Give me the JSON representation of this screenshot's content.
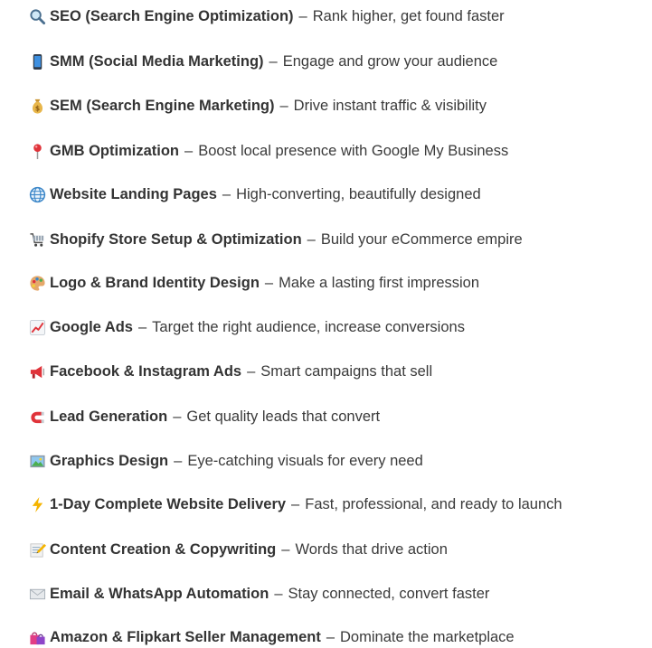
{
  "services": [
    {
      "icon": "magnifying-glass-icon",
      "name": "SEO (Search Engine Optimization)",
      "separator": "–",
      "description": "Rank higher, get found faster"
    },
    {
      "icon": "mobile-phone-icon",
      "name": "SMM (Social Media Marketing)",
      "separator": "–",
      "description": "Engage and grow your audience"
    },
    {
      "icon": "money-bag-icon",
      "name": "SEM (Search Engine Marketing)",
      "separator": "–",
      "description": "Drive instant traffic & visibility"
    },
    {
      "icon": "map-pin-icon",
      "name": "GMB Optimization",
      "separator": "–",
      "description": "Boost local presence with Google My Business"
    },
    {
      "icon": "globe-icon",
      "name": "Website Landing Pages",
      "separator": "–",
      "description": "High-converting, beautifully designed"
    },
    {
      "icon": "shopping-cart-icon",
      "name": "Shopify Store Setup & Optimization",
      "separator": "–",
      "description": "Build your eCommerce empire"
    },
    {
      "icon": "artist-palette-icon",
      "name": "Logo & Brand Identity Design",
      "separator": "–",
      "description": "Make a lasting first impression"
    },
    {
      "icon": "chart-increasing-icon",
      "name": "Google Ads",
      "separator": "–",
      "description": "Target the right audience, increase conversions"
    },
    {
      "icon": "megaphone-icon",
      "name": "Facebook & Instagram Ads",
      "separator": "–",
      "description": "Smart campaigns that sell"
    },
    {
      "icon": "magnet-icon",
      "name": "Lead Generation",
      "separator": "–",
      "description": "Get quality leads that convert"
    },
    {
      "icon": "framed-picture-icon",
      "name": "Graphics Design",
      "separator": "–",
      "description": "Eye-catching visuals for every need"
    },
    {
      "icon": "lightning-bolt-icon",
      "name": "1-Day Complete Website Delivery",
      "separator": "–",
      "description": "Fast, professional, and ready to launch"
    },
    {
      "icon": "memo-icon",
      "name": "Content Creation & Copywriting",
      "separator": "–",
      "description": "Words that drive action"
    },
    {
      "icon": "envelope-icon",
      "name": "Email & WhatsApp Automation",
      "separator": "–",
      "description": "Stay connected, convert faster"
    },
    {
      "icon": "shopping-bags-icon",
      "name": "Amazon & Flipkart Seller Management",
      "separator": "–",
      "description": "Dominate the marketplace"
    }
  ]
}
